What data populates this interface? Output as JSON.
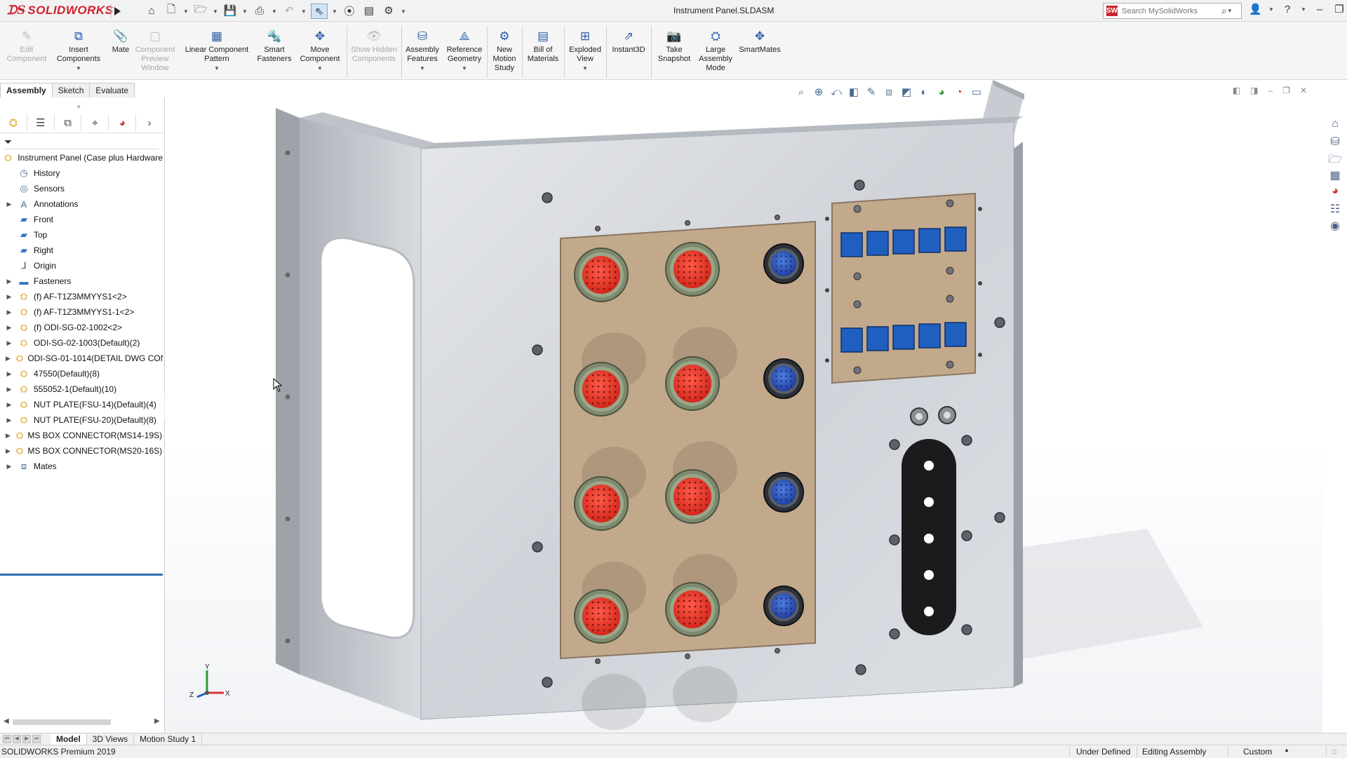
{
  "window": {
    "app_brand": "SOLIDWORKS",
    "document_title": "Instrument Panel.SLDASM"
  },
  "search": {
    "placeholder": "Search MySolidWorks",
    "brand_badge": "SW"
  },
  "command_manager": {
    "edit_component": "Edit Component",
    "insert_components": "Insert Components",
    "mate": "Mate",
    "component_preview_window": "Component Preview Window",
    "linear_component_pattern": "Linear Component Pattern",
    "smart_fasteners": "Smart Fasteners",
    "move_component": "Move Component",
    "show_hidden_components": "Show Hidden Components",
    "assembly_features": "Assembly Features",
    "reference_geometry": "Reference Geometry",
    "new_motion_study": "New Motion Study",
    "bill_of_materials": "Bill of Materials",
    "exploded_view": "Exploded View",
    "instant3d": "Instant3D",
    "take_snapshot": "Take Snapshot",
    "large_assembly_mode": "Large Assembly Mode",
    "smartmates": "SmartMates"
  },
  "tabs": {
    "assembly": "Assembly",
    "sketch": "Sketch",
    "evaluate": "Evaluate"
  },
  "tree": {
    "root": "Instrument Panel  (Case plus Hardware",
    "items": [
      "History",
      "Sensors",
      "Annotations",
      "Front",
      "Top",
      "Right",
      "Origin",
      "Fasteners",
      "(f) AF-T1Z3MMYYS1<2>",
      "(f) AF-T1Z3MMYYS1-1<2>",
      "(f) ODI-SG-02-1002<2>",
      "ODI-SG-02-1003(Default)(2)",
      "ODI-SG-01-1014(DETAIL DWG CON",
      "47550(Default)(8)",
      "555052-1(Default)(10)",
      "NUT PLATE(FSU-14)(Default)(4)",
      "NUT PLATE(FSU-20)(Default)(8)",
      "MS BOX CONNECTOR(MS14-19S)(",
      "MS BOX CONNECTOR(MS20-16S)(",
      "Mates"
    ]
  },
  "triad": {
    "x": "X",
    "y": "Y",
    "z": "Z"
  },
  "bottom_tabs": {
    "model": "Model",
    "views_3d": "3D Views",
    "motion_study": "Motion Study 1"
  },
  "status": {
    "app_version": "SOLIDWORKS Premium 2019",
    "definition": "Under Defined",
    "mode": "Editing Assembly",
    "units": "Custom"
  }
}
